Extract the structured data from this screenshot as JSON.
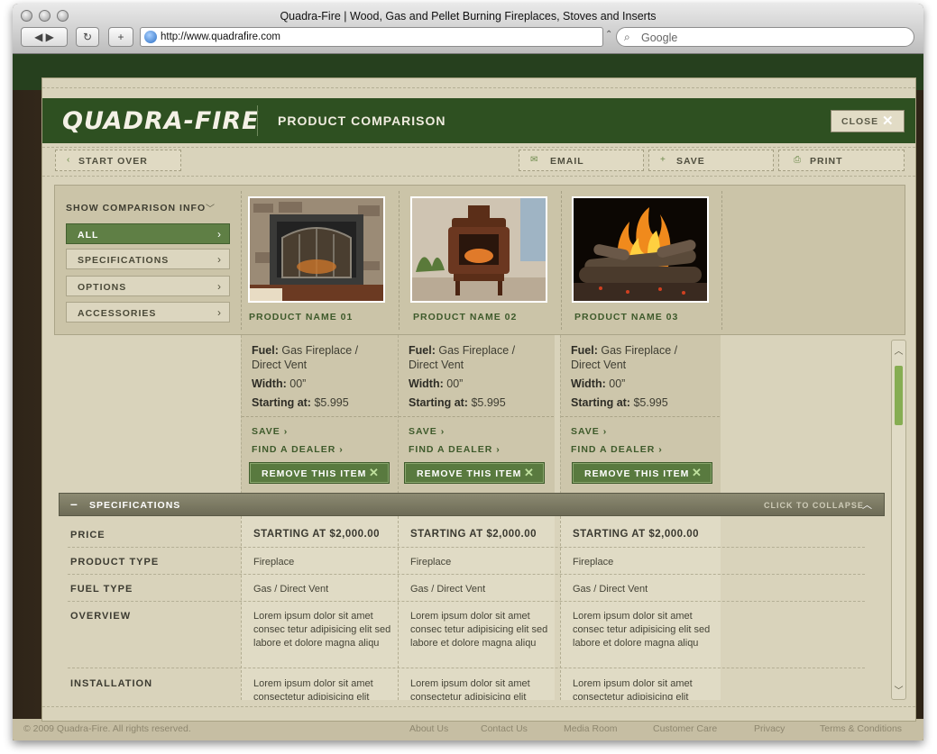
{
  "browser": {
    "title": "Quadra-Fire  |  Wood, Gas and Pellet Burning Fireplaces, Stoves and Inserts",
    "url": "http://www.quadrafire.com",
    "search_placeholder": "Google",
    "back_glyph": "◀ ▶",
    "reload_glyph": "↻",
    "add_glyph": "+",
    "addr_arrows": "⌃",
    "search_glyph": "⌕"
  },
  "site_footer": {
    "copyright": "© 2009 Quadra-Fire. All rights reserved.",
    "links": [
      "About Us",
      "Contact Us",
      "Media Room",
      "Customer Care",
      "Privacy",
      "Terms & Conditions"
    ]
  },
  "modal": {
    "logo": "QUADRA-FIRE",
    "title": "PRODUCT COMPARISON",
    "close_label": "CLOSE"
  },
  "toolbar": {
    "start_over": "START OVER",
    "email": "EMAIL",
    "save": "SAVE",
    "print": "PRINT"
  },
  "comparison_filter": {
    "label": "SHOW COMPARISON INFO",
    "items": [
      "ALL",
      "SPECIFICATIONS",
      "OPTIONS",
      "ACCESSORIES"
    ],
    "active": "ALL"
  },
  "products": [
    {
      "name": "PRODUCT NAME 01",
      "fuel_label": "Fuel:",
      "fuel_value": "Gas Fireplace /",
      "fuel_value2": "Direct Vent",
      "width_label": "Width:",
      "width_value": "00”",
      "price_label": "Starting at:",
      "price_value": "$5.995",
      "save_link": "SAVE",
      "dealer_link": "FIND A DEALER",
      "remove_label": "REMOVE THIS ITEM"
    },
    {
      "name": "PRODUCT NAME 02",
      "fuel_label": "Fuel:",
      "fuel_value": "Gas Fireplace /",
      "fuel_value2": "Direct Vent",
      "width_label": "Width:",
      "width_value": "00”",
      "price_label": "Starting at:",
      "price_value": "$5.995",
      "save_link": "SAVE",
      "dealer_link": "FIND A DEALER",
      "remove_label": "REMOVE THIS ITEM"
    },
    {
      "name": "PRODUCT NAME 03",
      "fuel_label": "Fuel:",
      "fuel_value": "Gas Fireplace /",
      "fuel_value2": "Direct Vent",
      "width_label": "Width:",
      "width_value": "00”",
      "price_label": "Starting at:",
      "price_value": "$5.995",
      "save_link": "SAVE",
      "dealer_link": "FIND A DEALER",
      "remove_label": "REMOVE THIS ITEM"
    }
  ],
  "specifications": {
    "header": "SPECIFICATIONS",
    "collapse_label": "CLICK TO COLLAPSE",
    "rows": [
      {
        "label": "PRICE",
        "values": [
          "STARTING AT $2,000.00",
          "STARTING AT $2,000.00",
          "STARTING AT $2,000.00"
        ]
      },
      {
        "label": "PRODUCT TYPE",
        "values": [
          "Fireplace",
          "Fireplace",
          "Fireplace"
        ]
      },
      {
        "label": "FUEL TYPE",
        "values": [
          "Gas / Direct Vent",
          "Gas / Direct Vent",
          "Gas / Direct Vent"
        ]
      },
      {
        "label": "OVERVIEW",
        "values": [
          "Lorem ipsum dolor sit amet consec tetur adipisicing elit sed labore et dolore magna aliqu",
          "Lorem ipsum dolor sit amet consec tetur adipisicing elit sed labore et dolore magna aliqu",
          "Lorem ipsum dolor sit amet consec tetur adipisicing elit sed labore et dolore magna aliqu"
        ]
      },
      {
        "label": "INSTALLATION",
        "values": [
          "Lorem ipsum dolor sit amet consectetur adipisicing elit",
          "Lorem ipsum dolor sit amet consectetur adipisicing elit",
          "Lorem ipsum dolor sit amet consectetur adipisicing elit"
        ]
      }
    ]
  }
}
